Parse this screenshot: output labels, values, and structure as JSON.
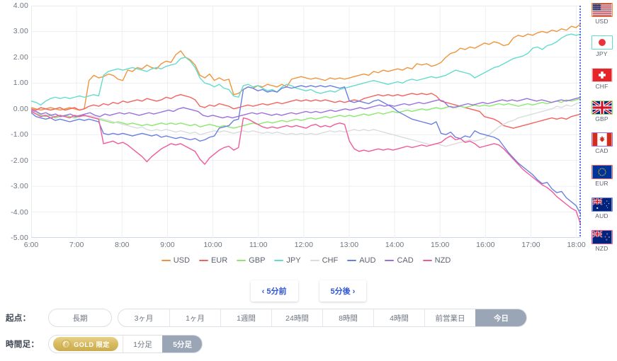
{
  "chart_data": {
    "type": "line",
    "title": "",
    "xlabel": "",
    "ylabel": "",
    "grid": true,
    "legend_position": "bottom",
    "ylim": [
      -5.0,
      4.0
    ],
    "ytick_labels": [
      "4.00",
      "3.00",
      "2.00",
      "1.00",
      "0.00",
      "-1.00",
      "-2.00",
      "-3.00",
      "-4.00",
      "-5.00"
    ],
    "ytick_values": [
      4,
      3,
      2,
      1,
      0,
      -1,
      -2,
      -3,
      -4,
      -5
    ],
    "xtick_labels": [
      "6:00",
      "7:00",
      "8:00",
      "9:00",
      "10:00",
      "11:00",
      "12:00",
      "13:00",
      "14:00",
      "15:00",
      "16:00",
      "17:00",
      "18:00"
    ],
    "x_start_hour": 6,
    "x_end_hour": 18.1,
    "series": [
      {
        "name": "USD",
        "color": "#f0943c",
        "values": [
          0.05,
          0.0,
          -0.05,
          0.0,
          0.05,
          0.0,
          -0.05,
          0.0,
          0.05,
          0.0,
          -0.05,
          0.0,
          1.1,
          1.3,
          1.2,
          1.25,
          1.35,
          1.3,
          1.15,
          1.1,
          1.5,
          1.45,
          1.6,
          1.55,
          1.7,
          1.6,
          1.55,
          1.75,
          1.85,
          1.8,
          2.1,
          2.25,
          2.0,
          1.9,
          1.7,
          1.3,
          1.2,
          1.35,
          1.1,
          1.2,
          1.1,
          1.15,
          0.55,
          0.6,
          0.75,
          0.85,
          0.8,
          0.9,
          0.85,
          0.95,
          0.9,
          0.85,
          0.95,
          0.85,
          1.15,
          1.2,
          1.25,
          1.2,
          1.15,
          1.2,
          1.15,
          1.1,
          1.2,
          1.15,
          1.2,
          1.15,
          1.2,
          1.25,
          1.3,
          1.35,
          1.3,
          1.45,
          1.4,
          1.5,
          1.45,
          1.5,
          1.55,
          1.5,
          1.6,
          1.55,
          1.75,
          1.7,
          1.75,
          1.65,
          1.7,
          1.8,
          2.0,
          2.15,
          2.2,
          2.35,
          2.3,
          2.4,
          2.35,
          2.45,
          2.55,
          2.5,
          2.6,
          2.55,
          2.45,
          2.5,
          2.75,
          2.85,
          2.8,
          2.9,
          2.85,
          2.95,
          3.0,
          2.95,
          3.05,
          3.0,
          3.1,
          3.05,
          3.2,
          3.15,
          3.3
        ]
      },
      {
        "name": "EUR",
        "color": "#f5615c",
        "values": [
          0.0,
          -0.05,
          0.05,
          0.0,
          -0.05,
          0.0,
          0.05,
          -0.05,
          0.0,
          0.05,
          -0.05,
          0.0,
          0.1,
          0.15,
          0.1,
          0.2,
          0.15,
          0.25,
          0.2,
          0.3,
          0.25,
          0.3,
          0.35,
          0.3,
          0.4,
          0.35,
          0.3,
          0.35,
          0.45,
          0.4,
          0.5,
          0.55,
          0.5,
          0.45,
          0.35,
          0.1,
          0.05,
          0.15,
          0.1,
          0.2,
          0.15,
          0.1,
          0.0,
          0.05,
          0.1,
          0.15,
          0.1,
          0.15,
          0.2,
          0.15,
          0.2,
          0.25,
          0.2,
          0.25,
          0.3,
          0.35,
          0.3,
          0.35,
          0.3,
          0.35,
          0.3,
          0.35,
          0.3,
          0.25,
          0.3,
          0.25,
          0.3,
          0.35,
          0.3,
          0.4,
          0.45,
          0.5,
          0.55,
          0.5,
          0.55,
          0.5,
          0.55,
          0.5,
          0.55,
          0.6,
          0.55,
          0.6,
          0.55,
          0.6,
          0.5,
          0.3,
          0.25,
          0.2,
          0.15,
          0.1,
          0.05,
          0.0,
          -0.05,
          -0.1,
          -0.3,
          -0.35,
          -0.4,
          -0.5,
          -0.65,
          -0.7,
          -0.75,
          -0.7,
          -0.65,
          -0.6,
          -0.55,
          -0.5,
          -0.45,
          -0.4,
          -0.35,
          -0.4,
          -0.35,
          -0.4,
          -0.3,
          -0.25,
          -0.2
        ]
      },
      {
        "name": "GBP",
        "color": "#8ae86e",
        "values": [
          -0.1,
          -0.15,
          -0.25,
          -0.3,
          -0.25,
          -0.35,
          -0.3,
          -0.25,
          -0.3,
          -0.35,
          -0.3,
          -0.25,
          -0.3,
          -0.35,
          -0.4,
          -0.45,
          -0.5,
          -0.55,
          -0.5,
          -0.55,
          -0.6,
          -0.55,
          -0.6,
          -0.65,
          -0.6,
          -0.65,
          -0.6,
          -0.55,
          -0.6,
          -0.55,
          -0.6,
          -0.55,
          -0.6,
          -0.65,
          -0.6,
          -0.7,
          -0.65,
          -0.6,
          -0.65,
          -0.7,
          -0.65,
          -0.7,
          -0.75,
          -0.7,
          -0.65,
          -0.6,
          -0.55,
          -0.6,
          -0.55,
          -0.5,
          -0.55,
          -0.5,
          -0.45,
          -0.5,
          -0.45,
          -0.4,
          -0.45,
          -0.4,
          -0.35,
          -0.4,
          -0.35,
          -0.3,
          -0.35,
          -0.3,
          -0.25,
          -0.3,
          -0.25,
          -0.3,
          -0.25,
          -0.2,
          -0.25,
          -0.2,
          -0.15,
          -0.2,
          -0.15,
          -0.1,
          -0.15,
          -0.1,
          -0.05,
          -0.1,
          -0.05,
          0.0,
          -0.05,
          0.0,
          0.05,
          0.0,
          0.05,
          0.1,
          0.05,
          0.1,
          0.05,
          0.1,
          0.15,
          0.1,
          0.15,
          0.1,
          0.15,
          0.2,
          0.15,
          0.2,
          0.15,
          0.1,
          0.15,
          0.2,
          0.15,
          0.2,
          0.25,
          0.2,
          0.25,
          0.3,
          0.25,
          0.35,
          0.3,
          0.35,
          0.4
        ]
      },
      {
        "name": "JPY",
        "color": "#63dccc",
        "values": [
          0.3,
          0.25,
          0.15,
          0.3,
          0.4,
          0.45,
          0.4,
          0.45,
          0.4,
          0.45,
          0.5,
          0.45,
          0.5,
          0.55,
          0.5,
          1.3,
          1.45,
          1.5,
          1.55,
          1.5,
          1.55,
          1.6,
          1.55,
          1.5,
          1.45,
          1.55,
          1.6,
          1.55,
          1.65,
          1.7,
          1.75,
          1.95,
          2.0,
          1.85,
          1.6,
          1.2,
          1.0,
          0.95,
          0.85,
          0.95,
          0.8,
          0.75,
          0.5,
          0.45,
          0.9,
          0.95,
          0.85,
          0.9,
          0.8,
          0.7,
          0.75,
          0.65,
          0.85,
          0.95,
          0.9,
          0.8,
          0.75,
          0.7,
          0.75,
          0.65,
          0.6,
          0.65,
          0.7,
          0.65,
          0.75,
          0.8,
          0.85,
          0.9,
          0.95,
          1.0,
          1.05,
          1.1,
          1.05,
          1.0,
          0.95,
          1.0,
          1.05,
          1.0,
          1.1,
          1.15,
          1.1,
          1.15,
          1.2,
          1.25,
          1.2,
          1.25,
          1.3,
          1.4,
          1.5,
          1.45,
          1.4,
          1.35,
          1.2,
          1.3,
          1.4,
          1.5,
          1.6,
          1.65,
          1.75,
          1.85,
          1.95,
          2.0,
          2.05,
          2.15,
          2.35,
          2.4,
          2.3,
          2.45,
          2.5,
          2.6,
          2.75,
          2.85,
          2.9,
          2.85,
          2.9
        ]
      },
      {
        "name": "CHF",
        "color": "#d9dbdd",
        "values": [
          -0.05,
          -0.15,
          -0.2,
          -0.25,
          -0.2,
          -0.3,
          -0.25,
          -0.3,
          -0.35,
          -0.3,
          -0.25,
          -0.3,
          -0.25,
          -0.3,
          -0.35,
          -0.4,
          -0.45,
          -0.5,
          -0.55,
          -0.6,
          -0.65,
          -0.7,
          -0.75,
          -0.7,
          -0.8,
          -0.85,
          -0.8,
          -0.85,
          -0.8,
          -0.85,
          -0.9,
          -0.85,
          -0.9,
          -0.95,
          -0.9,
          -1.0,
          -0.95,
          -0.9,
          -0.85,
          -0.9,
          -0.85,
          -0.9,
          -0.95,
          -0.9,
          -0.85,
          -0.9,
          -0.85,
          -0.9,
          -0.95,
          -0.9,
          -0.95,
          -0.9,
          -0.95,
          -1.0,
          -0.95,
          -1.0,
          -0.95,
          -1.0,
          -0.95,
          -1.0,
          -0.95,
          -0.9,
          -0.85,
          -0.9,
          -0.85,
          -0.9,
          -0.85,
          -0.8,
          -0.85,
          -0.8,
          -0.85,
          -0.8,
          -0.85,
          -0.9,
          -0.95,
          -1.0,
          -1.05,
          -1.1,
          -1.15,
          -1.2,
          -1.25,
          -1.3,
          -1.35,
          -1.4,
          -1.35,
          -1.4,
          -1.45,
          -1.4,
          -1.35,
          -1.3,
          -1.25,
          -1.2,
          -1.25,
          -1.2,
          -1.15,
          -1.0,
          -0.85,
          -0.7,
          -0.6,
          -0.5,
          -0.45,
          -0.35,
          -0.3,
          -0.25,
          -0.2,
          -0.15,
          -0.1,
          -0.05,
          0.0,
          0.1,
          0.05,
          0.15,
          0.1,
          0.2,
          0.25
        ]
      },
      {
        "name": "AUD",
        "color": "#6a7fe0",
        "values": [
          -0.15,
          -0.3,
          -0.35,
          -0.4,
          -0.35,
          -0.45,
          -0.4,
          -0.45,
          -0.5,
          -0.45,
          -0.4,
          -0.45,
          -0.4,
          -0.45,
          -0.5,
          -0.95,
          -1.0,
          -0.95,
          -1.0,
          -0.95,
          -1.0,
          -1.05,
          -1.0,
          -0.95,
          -1.0,
          -1.05,
          -1.0,
          -1.1,
          -1.05,
          -1.1,
          -1.15,
          -1.1,
          -1.15,
          -1.2,
          -1.15,
          -1.25,
          -1.2,
          -1.1,
          -1.05,
          -0.75,
          -0.7,
          -0.65,
          -0.45,
          -0.4,
          0.75,
          0.85,
          0.8,
          0.7,
          0.75,
          0.65,
          0.7,
          0.65,
          0.8,
          0.85,
          0.8,
          0.85,
          0.9,
          0.85,
          0.9,
          0.85,
          0.9,
          0.85,
          0.9,
          0.85,
          0.8,
          0.85,
          0.3,
          0.25,
          0.3,
          0.25,
          0.2,
          0.3,
          0.35,
          0.25,
          0.15,
          0.05,
          -0.1,
          -0.2,
          -0.3,
          -0.4,
          -0.45,
          -0.5,
          -0.55,
          -0.6,
          -0.5,
          -0.95,
          -1.0,
          -0.9,
          -1.1,
          -1.15,
          -1.05,
          -1.1,
          -0.85,
          -0.95,
          -1.0,
          -1.05,
          -1.1,
          -1.2,
          -1.45,
          -1.7,
          -1.9,
          -2.1,
          -2.25,
          -2.4,
          -2.55,
          -2.75,
          -2.9,
          -2.85,
          -3.1,
          -3.25,
          -3.2,
          -3.45,
          -3.6,
          -3.75,
          -4.1
        ]
      },
      {
        "name": "CAD",
        "color": "#9b6fe0",
        "values": [
          -0.05,
          -0.1,
          -0.2,
          -0.15,
          -0.25,
          -0.2,
          -0.3,
          -0.25,
          -0.2,
          -0.3,
          -0.25,
          -0.2,
          -0.15,
          -0.25,
          -0.3,
          -0.2,
          -0.25,
          -0.2,
          -0.15,
          -0.2,
          -0.15,
          -0.2,
          -0.25,
          -0.2,
          -0.15,
          -0.2,
          -0.15,
          -0.1,
          -0.05,
          -0.1,
          0.0,
          0.05,
          0.0,
          -0.05,
          -0.1,
          -0.25,
          -0.3,
          -0.25,
          -0.3,
          -0.35,
          -0.3,
          -0.35,
          -0.3,
          -0.25,
          -0.2,
          -0.15,
          -0.2,
          -0.15,
          -0.2,
          -0.25,
          -0.2,
          -0.25,
          -0.2,
          -0.15,
          -0.2,
          -0.15,
          -0.1,
          -0.15,
          -0.1,
          -0.15,
          -0.1,
          -0.05,
          -0.1,
          -0.05,
          0.0,
          -0.05,
          0.0,
          0.05,
          0.0,
          0.05,
          0.1,
          0.15,
          0.1,
          0.15,
          0.1,
          0.15,
          0.2,
          0.15,
          0.2,
          0.25,
          0.2,
          0.25,
          0.3,
          0.35,
          0.3,
          0.1,
          0.05,
          0.1,
          0.15,
          0.2,
          0.15,
          0.2,
          0.25,
          0.2,
          0.25,
          0.3,
          0.35,
          0.3,
          0.35,
          0.3,
          0.35,
          0.4,
          0.35,
          0.3,
          0.35,
          0.3,
          0.25,
          0.3,
          0.35,
          0.3,
          0.35,
          0.4,
          0.45
        ]
      },
      {
        "name": "NZD",
        "color": "#f05a9b"
      }
    ],
    "nzd_values": [
      -0.1,
      -0.2,
      -0.3,
      -0.25,
      -0.35,
      -0.3,
      -0.25,
      -0.3,
      -0.35,
      -0.25,
      -0.3,
      -0.25,
      -0.3,
      -0.35,
      -0.4,
      -1.35,
      -1.3,
      -1.25,
      -1.35,
      -1.3,
      -1.4,
      -1.55,
      -1.7,
      -1.85,
      -2.05,
      -1.85,
      -1.7,
      -1.55,
      -1.45,
      -1.35,
      -1.4,
      -1.35,
      -1.45,
      -1.55,
      -1.65,
      -1.95,
      -2.15,
      -1.9,
      -1.75,
      -1.6,
      -1.5,
      -1.45,
      -1.6,
      -1.5,
      -0.35,
      -0.4,
      -0.5,
      -0.6,
      -0.7,
      -0.75,
      -0.7,
      -0.75,
      -0.7,
      -0.65,
      -0.7,
      -0.65,
      -0.7,
      -0.75,
      -0.65,
      -0.6,
      -0.7,
      -0.65,
      -0.7,
      -0.6,
      -0.55,
      -0.6,
      -1.25,
      -1.55,
      -1.65,
      -1.6,
      -1.65,
      -1.6,
      -1.55,
      -1.6,
      -1.55,
      -1.6,
      -1.55,
      -1.5,
      -1.45,
      -1.5,
      -1.45,
      -1.4,
      -1.45,
      -1.4,
      -1.35,
      -1.3,
      -1.15,
      -1.05,
      -1.2,
      -1.15,
      -1.3,
      -1.25,
      -1.35,
      -1.5,
      -1.45,
      -1.4,
      -1.35,
      -1.4,
      -1.55,
      -1.75,
      -1.95,
      -2.15,
      -2.35,
      -2.5,
      -2.65,
      -2.8,
      -2.95,
      -3.05,
      -3.2,
      -3.4,
      -3.55,
      -3.7,
      -3.85,
      -3.95,
      -4.5
    ],
    "current_time_marker": {
      "label": "",
      "color": "#2f55d4",
      "style": "dotted"
    }
  },
  "flag_rail": {
    "items": [
      {
        "code": "USD",
        "color": "#f0943c",
        "flag": "us-flag"
      },
      {
        "code": "JPY",
        "color": "#63dccc",
        "flag": "jp-flag"
      },
      {
        "code": "CHF",
        "color": "#d9dbdd",
        "flag": "ch-flag"
      },
      {
        "code": "GBP",
        "color": "#8ae86e",
        "flag": "gb-flag"
      },
      {
        "code": "CAD",
        "color": "#9b6fe0",
        "flag": "ca-flag"
      },
      {
        "code": "EUR",
        "color": "#f5615c",
        "flag": "eu-flag"
      },
      {
        "code": "AUD",
        "color": "#6a7fe0",
        "flag": "au-flag"
      },
      {
        "code": "NZD",
        "color": "#f05a9b",
        "flag": "nz-flag"
      }
    ]
  },
  "nav": {
    "prev_label": "‹ 5分前",
    "next_label": "5分後 ›"
  },
  "controls": {
    "origin": {
      "label": "起点：",
      "solo": "長期",
      "options": [
        "3ヶ月",
        "1ヶ月",
        "1週間",
        "24時間",
        "8時間",
        "4時間",
        "前営業日",
        "今日"
      ],
      "selected": "今日"
    },
    "timeframe": {
      "label": "時間足：",
      "gold_badge": "GOLD 限定",
      "options": [
        "1分足",
        "5分足"
      ],
      "selected": "5分足"
    }
  }
}
